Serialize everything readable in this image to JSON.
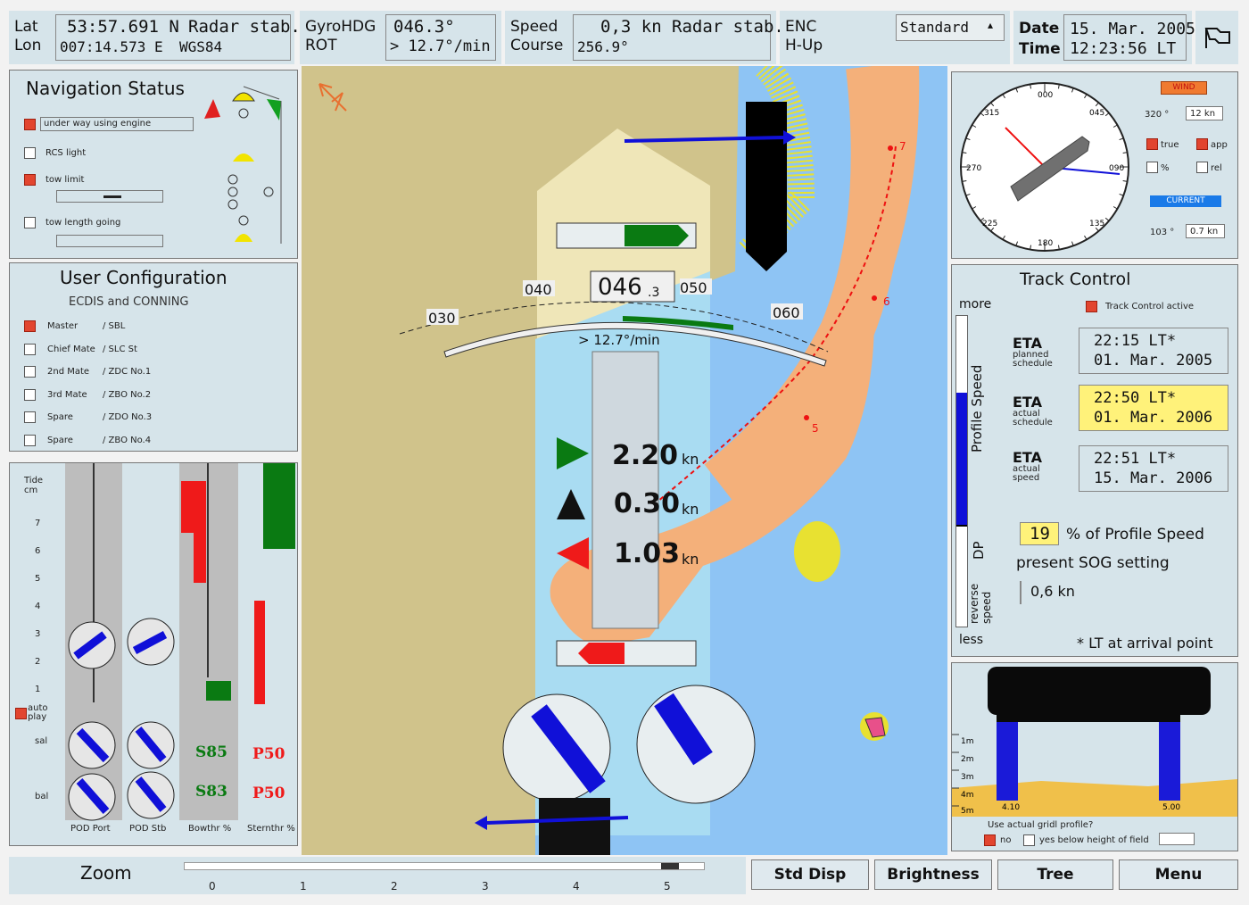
{
  "top": {
    "lat_label": "Lat",
    "lon_label": "Lon",
    "lat_value": "53:57.691 N",
    "lon_value": "007:14.573 E",
    "pos_mode": "Radar stab.",
    "datum": "WGS84",
    "gyro_label": "GyroHDG",
    "rot_label": "ROT",
    "gyro_value": "046.3°",
    "rot_value": "> 12.7°/min",
    "speed_label": "Speed",
    "course_label": "Course",
    "speed_value": "0,3 kn",
    "speed_mode": "Radar stab.",
    "course_value": "256.9°",
    "enc_label": "ENC",
    "hup_label": "H-Up",
    "display_mode": "Standard",
    "date_label": "Date",
    "time_label": "Time",
    "date_value": "15. Mar. 2005",
    "time_value": "12:23:56 LT"
  },
  "nav_status": {
    "title": "Navigation Status",
    "items": [
      {
        "label": "under way using engine",
        "checked": true
      },
      {
        "label": "RCS light",
        "checked": false
      },
      {
        "label": "tow limit",
        "checked": true
      },
      {
        "label": "tow length going",
        "checked": false
      }
    ]
  },
  "user_config": {
    "title": "User Configuration",
    "subtitle": "ECDIS and CONNING",
    "rows": [
      {
        "role": "Master",
        "station": "/ SBL",
        "checked": true
      },
      {
        "role": "Chief Mate",
        "station": "/ SLC St",
        "checked": false
      },
      {
        "role": "2nd Mate",
        "station": "/ ZDC No.1",
        "checked": false
      },
      {
        "role": "3rd Mate",
        "station": "/ ZBO No.2",
        "checked": false
      },
      {
        "role": "Spare",
        "station": "/ ZDO No.3",
        "checked": false
      },
      {
        "role": "Spare",
        "station": "/ ZBO No.4",
        "checked": false
      }
    ]
  },
  "propulsion": {
    "scale_label": "Tide cm",
    "scale_ticks": [
      "7",
      "6",
      "5",
      "4",
      "3",
      "2",
      "1"
    ],
    "auto_play_label": "auto play",
    "sal_label": "sal",
    "bal_label": "bal",
    "bow_value": "S85",
    "bow_value2": "S83",
    "stern_value": "P50",
    "stern_value2": "P50",
    "columns": [
      "POD Port",
      "POD Stb",
      "Bowthr %",
      "Sternthr %"
    ]
  },
  "chart": {
    "hdg_ticks": [
      "030",
      "040",
      "050",
      "060"
    ],
    "heading_main": "046",
    "heading_dec": ".3",
    "rot_text": "> 12.7°/min",
    "speed_long": "2.20",
    "speed_trans": "0.30",
    "speed_stern": "1.03",
    "unit": "kn",
    "wp_labels": [
      "7",
      "6",
      "5"
    ]
  },
  "wind": {
    "title": "WIND",
    "dir": "320 °",
    "speed": "12 kn",
    "opt_true": "true",
    "opt_app": "app",
    "opt_pct": "%",
    "opt_rel": "rel",
    "current_title": "CURRENT",
    "cur_dir": "103 °",
    "cur_speed": "0.7 kn",
    "compass_labels": [
      "000",
      "045",
      "090",
      "135",
      "180",
      "225",
      "270",
      "315"
    ]
  },
  "track": {
    "title": "Track Control",
    "more": "more",
    "less": "less",
    "profile_speed": "Profile Speed",
    "dp": "DP",
    "reverse_speed": "reverse speed",
    "track_active_label": "Track Control active",
    "eta": "ETA",
    "sub1": "planned schedule",
    "sub2": "actual schedule",
    "sub3": "actual speed",
    "eta1_time": "22:15 LT*",
    "eta1_date": "01. Mar. 2005",
    "eta2_time": "22:50 LT*",
    "eta2_date": "01. Mar. 2006",
    "eta3_time": "22:51 LT*",
    "eta3_date": "15. Mar. 2006",
    "percent_value": "19",
    "percent_label": "% of Profile Speed",
    "sog_label": "present SOG setting",
    "sog_value": "0,6 kn",
    "footnote": "* LT at arrival point"
  },
  "clearance": {
    "depth_labels": [
      "1m",
      "2m",
      "3m",
      "4m",
      "5m"
    ],
    "left_value": "4.10",
    "right_value": "5.00",
    "question": "Use actual gridl profile?",
    "opt_no": "no",
    "opt_yes": "yes below height of field"
  },
  "bottom": {
    "zoom": "Zoom",
    "zoom_ticks": [
      "0",
      "1",
      "2",
      "3",
      "4",
      "5"
    ],
    "buttons": [
      "Std Disp",
      "Brightness",
      "Tree",
      "Menu"
    ]
  },
  "colors": {
    "land": "#d0c38b",
    "shallow": "#a9dcf2",
    "water": "#8ec4f4",
    "sand": "#f4b07a",
    "panel": "#d6e4ea",
    "accent_red": "#e2452f",
    "green": "#0a7a12",
    "blue": "#1010d8",
    "highlight": "#fff27a"
  }
}
